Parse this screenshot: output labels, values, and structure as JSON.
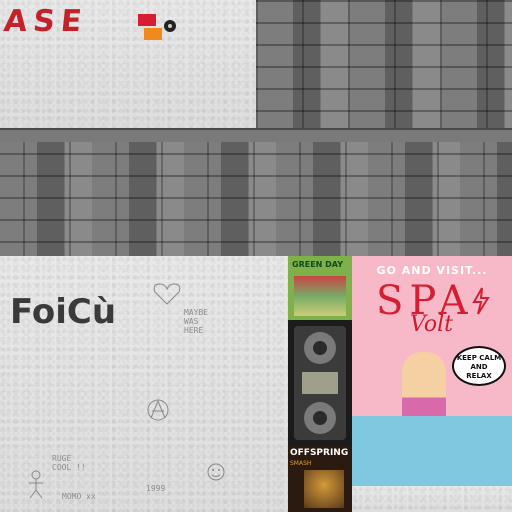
{
  "top_left": {
    "tag_text": "ASE",
    "tag_color": "#c4222b"
  },
  "sticker_icon": "dg-sticker-icon",
  "mid_left": {
    "tag_text": "FoiCù"
  },
  "scribbles": {
    "maybe": "MAYBE\nWAS\nHERE",
    "ruge": "RUGE\nCOOL !!",
    "momo": "MOMO xx",
    "num": "1999"
  },
  "posters": {
    "green_day": {
      "title": "GREEN DAY"
    },
    "boombox": {
      "icon": "boombox-icon"
    },
    "offspring": {
      "title": "OFFSPRING",
      "subtitle": "SMASH"
    },
    "spa": {
      "top": "GO AND VISIT...",
      "title": "SPA",
      "subtitle": "Volt",
      "bubble": "KEEP CALM\nAND\nRELAX",
      "brand_color": "#d61e33",
      "bg_color": "#f7b9c7"
    }
  }
}
